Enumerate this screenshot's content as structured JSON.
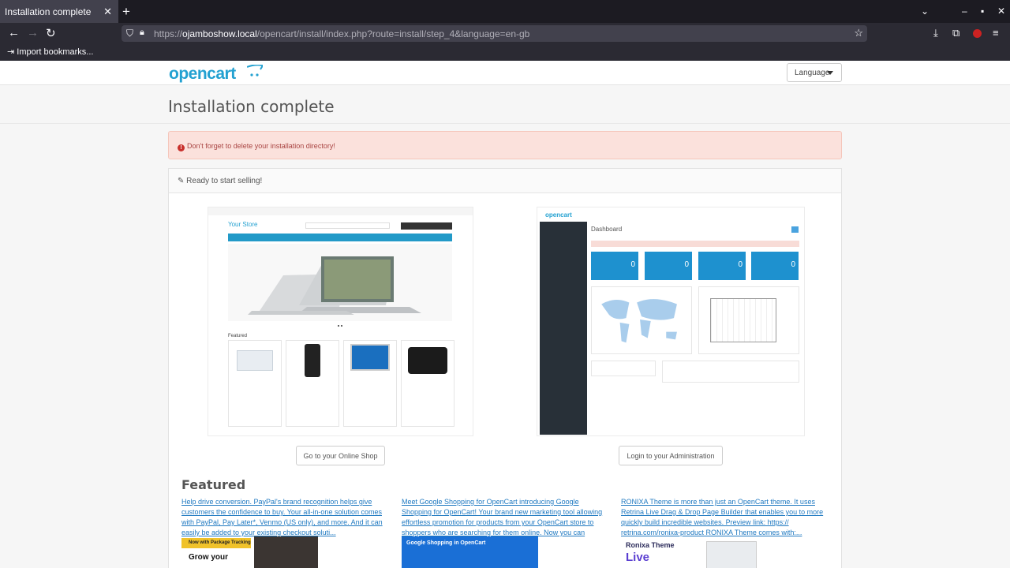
{
  "browser": {
    "tab_title": "Installation complete",
    "tab_close": "✕",
    "new_tab": "+",
    "url_prefix": "https://",
    "url_host": "ojamboshow.local",
    "url_path": "/opencart/install/index.php?route=install/step_4&language=en-gb",
    "bookmarks_item": "Import bookmarks..."
  },
  "header": {
    "logo_text": "opencart",
    "language_button": "Language"
  },
  "page": {
    "title": "Installation complete",
    "alert": "Don't forget to delete your installation directory!",
    "panel_heading": "Ready to start selling!",
    "shop_button": "Go to your Online Shop",
    "admin_button": "Login to your Administration"
  },
  "store_preview": {
    "brand": "Your Store",
    "featured_label": "Featured"
  },
  "admin_preview": {
    "brand": "opencart",
    "title": "Dashboard",
    "tile_values": [
      "0",
      "0",
      "0",
      "0"
    ]
  },
  "featured": {
    "title": "Featured",
    "items": [
      {
        "text": "Help drive conversion. PayPal's brand recognition helps give customers the confidence to buy. Your all-in-one solution comes with PayPal, Pay Later*, Venmo (US only), and more. And it can easily be added to your existing checkout soluti..."
      },
      {
        "text": "Meet Google Shopping for OpenCart introducing Google Shopping for OpenCart! Your brand new marketing tool allowing effortless promotion for products from your OpenCart store to shoppers who are searching for them online. Now you can displa..."
      },
      {
        "text": "RONIXA Theme is more than just an OpenCart theme. It uses Retrina Live Drag & Drop Page Builder that enables you to more quickly build incredible websites. Preview link: https:// retrina.com/ronixa-product RONIXA Theme comes with:..."
      }
    ],
    "banners": [
      {
        "tag": "Now with Package Tracking",
        "headline": "Grow your"
      },
      {
        "headline": "Google Shopping in OpenCart"
      },
      {
        "headline": "Ronixa Theme",
        "sub": "Live"
      }
    ]
  },
  "colors": {
    "brand": "#23a1d1",
    "link": "#1f79c1",
    "alert_bg": "#fbe1dc"
  }
}
